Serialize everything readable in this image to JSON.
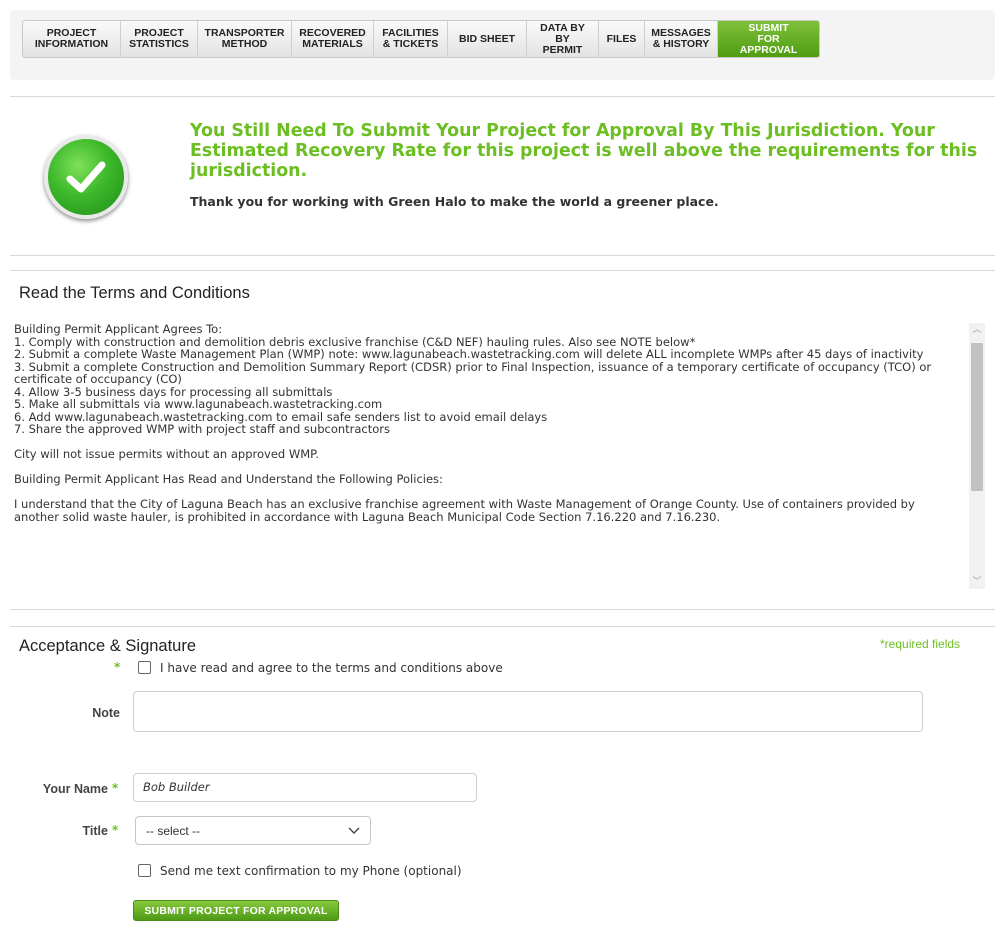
{
  "tabs": [
    {
      "label": "PROJECT\nINFORMATION",
      "active": false
    },
    {
      "label": "PROJECT\nSTATISTICS",
      "active": false
    },
    {
      "label": "TRANSPORTER\nMETHOD",
      "active": false
    },
    {
      "label": "RECOVERED\nMATERIALS",
      "active": false
    },
    {
      "label": "FACILITIES\n& TICKETS",
      "active": false
    },
    {
      "label": "BID SHEET",
      "active": false
    },
    {
      "label": "DATA BY\nBY PERMIT",
      "active": false
    },
    {
      "label": "FILES",
      "active": false
    },
    {
      "label": "MESSAGES\n& HISTORY",
      "active": false
    },
    {
      "label": "SUBMIT\nFOR APPROVAL",
      "active": true
    }
  ],
  "status": {
    "icon": "checkmark-icon",
    "headline": "You Still Need To Submit Your Project for Approval By This Jurisdiction. Your Estimated Recovery Rate for this project is well above the requirements for this jurisdiction.",
    "thanks": "Thank you for working with Green Halo to make the world a greener place."
  },
  "terms": {
    "title": "Read the Terms and Conditions",
    "text": "Building Permit Applicant Agrees To:\n1. Comply with construction and demolition debris exclusive franchise (C&D NEF) hauling rules. Also see NOTE below*\n2. Submit a complete Waste Management Plan (WMP) note: www.lagunabeach.wastetracking.com will delete ALL incomplete WMPs after 45 days of inactivity\n3. Submit a complete Construction and Demolition Summary Report (CDSR) prior to Final Inspection, issuance of a temporary certificate of occupancy (TCO) or certificate of occupancy (CO)\n4. Allow 3-5 business days for processing all submittals\n5. Make all submittals via www.lagunabeach.wastetracking.com\n6. Add www.lagunabeach.wastetracking.com to email safe senders list to avoid email delays\n7. Share the approved WMP with project staff and subcontractors\n\nCity will not issue permits without an approved WMP.\n\nBuilding Permit Applicant Has Read and Understand the Following Policies:\n\nI understand that the City of Laguna Beach has an exclusive franchise agreement with Waste Management of Orange County. Use of containers provided by another solid waste hauler, is prohibited in accordance with Laguna Beach Municipal Code Section 7.16.220 and 7.16.230."
  },
  "acceptance": {
    "title": "Acceptance & Signature",
    "required_note": "*required fields",
    "required_star": "*",
    "agree_label": "I have read and agree to the terms and conditions above",
    "note_label": "Note",
    "note_value": "",
    "name_label": "Your Name",
    "name_value": "Bob Builder",
    "title_label": "Title",
    "title_value": "-- select --",
    "sms_label": "Send me text confirmation to my Phone (optional)",
    "submit_label": "SUBMIT PROJECT FOR APPROVAL"
  }
}
